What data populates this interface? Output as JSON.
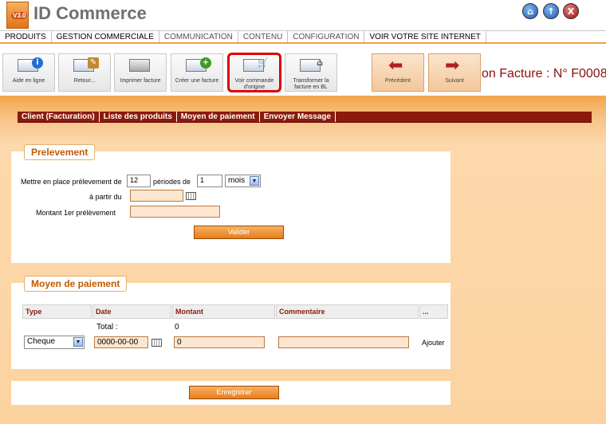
{
  "app": {
    "logo_badge": "V3.0",
    "title": "ID Commerce"
  },
  "top_buttons": {
    "home": "⌂",
    "up": "↑",
    "close": "X"
  },
  "menu": [
    "PRODUITS",
    "GESTION COMMERCIALE",
    "COMMUNICATION",
    "CONTENU",
    "CONFIGURATION",
    "VOIR VOTRE SITE INTERNET"
  ],
  "toolbar": {
    "help": "Aide en ligne",
    "back": "Retour...",
    "print": "Imprimer facture",
    "create": "Créer une facture",
    "view_order": "Voir commande d'origine",
    "transform": "Transformer la facture en BL",
    "prev": "Précédent",
    "next": "Suivant"
  },
  "page_title": "on Facture : N° F0008",
  "tabs": [
    "Client (Facturation)",
    "Liste des produits",
    "Moyen de paiement",
    "Envoyer Message"
  ],
  "prelevement": {
    "title": "Prelevement",
    "label_setup": "Mettre en place prélevement de",
    "periods_value": "12",
    "label_periods": "périodes de",
    "duration_value": "1",
    "unit_value": "mois",
    "label_from": "à partir du",
    "from_value": "",
    "label_amount": "Montant 1er prélèvement",
    "amount_value": "",
    "validate": "Valider"
  },
  "payment": {
    "title": "Moyen de paiement",
    "headers": [
      "Type",
      "Date",
      "Montant",
      "Commentaire",
      "..."
    ],
    "total_label": "Total :",
    "total_value": "0",
    "type_value": "Cheque",
    "date_value": "0000-00-00",
    "amount_value": "0",
    "comment_value": "",
    "add": "Ajouter"
  },
  "save": "Enregistrer"
}
